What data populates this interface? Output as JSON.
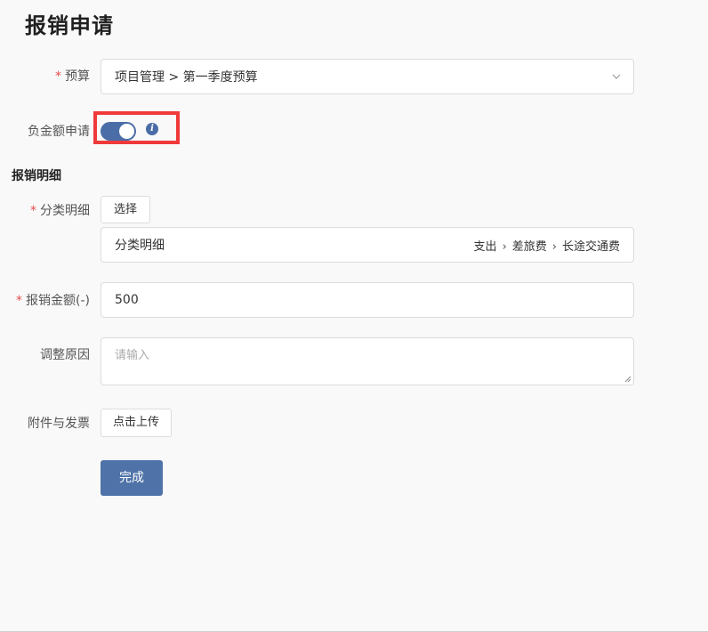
{
  "page": {
    "title": "报销申请"
  },
  "budget": {
    "label": "预算",
    "required_mark": "*",
    "value": "项目管理 > 第一季度预算"
  },
  "negative_amount": {
    "label": "负金额申请",
    "toggle_on": true,
    "info_glyph": "i"
  },
  "details_section": {
    "title": "报销明细"
  },
  "category": {
    "label": "分类明细",
    "required_mark": "*",
    "select_button": "选择",
    "row_label": "分类明细",
    "path": [
      "支出",
      "差旅费",
      "长途交通费"
    ]
  },
  "amount": {
    "label": "报销金额(-)",
    "required_mark": "*",
    "value": "500"
  },
  "reason": {
    "label": "调整原因",
    "placeholder": "请输入"
  },
  "attachments": {
    "label": "附件与发票",
    "upload_button": "点击上传"
  },
  "submit": {
    "label": "完成"
  },
  "colors": {
    "accent": "#4a6da7",
    "required": "#e84c4c",
    "highlight": "#f03a3a"
  }
}
